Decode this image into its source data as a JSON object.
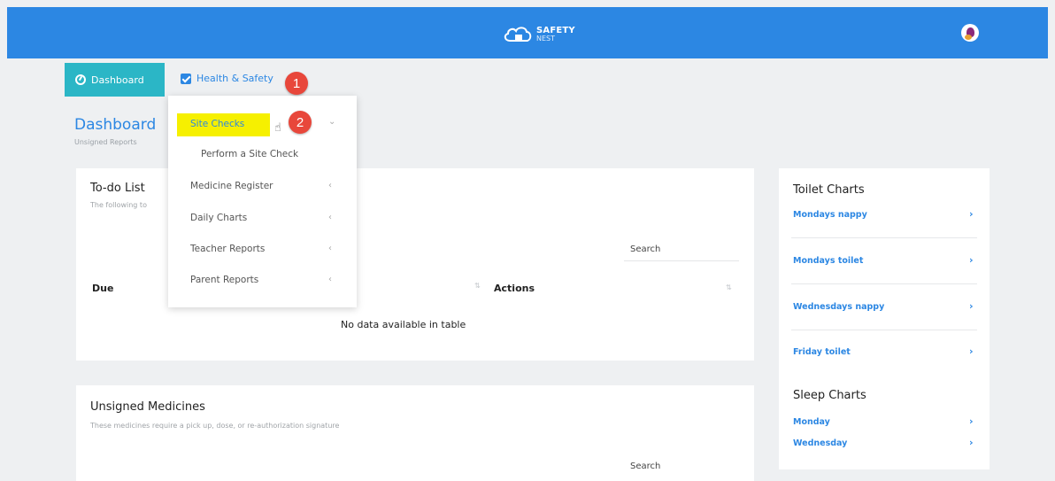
{
  "brand": {
    "title": "SAFETY",
    "subtitle": "NEST"
  },
  "nav": {
    "dashboard_label": "Dashboard",
    "health_label": "Health & Safety"
  },
  "annotations": [
    "1",
    "2"
  ],
  "page": {
    "title": "Dashboard",
    "subtitle": "Unsigned Reports"
  },
  "dropdown": {
    "items": [
      {
        "label": "Site Checks",
        "caret": "⌄"
      },
      {
        "label": "Perform a Site Check"
      },
      {
        "label": "Medicine Register",
        "caret": "‹"
      },
      {
        "label": "Daily Charts",
        "caret": "‹"
      },
      {
        "label": "Teacher Reports",
        "caret": "‹"
      },
      {
        "label": "Parent Reports",
        "caret": "‹"
      }
    ]
  },
  "todo": {
    "title": "To-do List",
    "subtitle": "The following to",
    "search_label": "Search",
    "columns": [
      "Due",
      "Actions"
    ],
    "empty": "No data available in table"
  },
  "medicines": {
    "title": "Unsigned Medicines",
    "subtitle": "These medicines require a pick up, dose, or re-authorization signature",
    "search_label": "Search"
  },
  "side": {
    "toilet_title": "Toilet Charts",
    "toilet_links": [
      "Mondays nappy",
      "Mondays toilet",
      "Wednesdays nappy",
      "Friday toilet"
    ],
    "sleep_title": "Sleep Charts",
    "sleep_links": [
      "Monday",
      "Wednesday"
    ],
    "chevron": "›"
  },
  "colors": {
    "topbar": "#2c87e3",
    "nav_active": "#2bb6c6",
    "badge": "#e8473b",
    "highlight": "#f6f000"
  }
}
